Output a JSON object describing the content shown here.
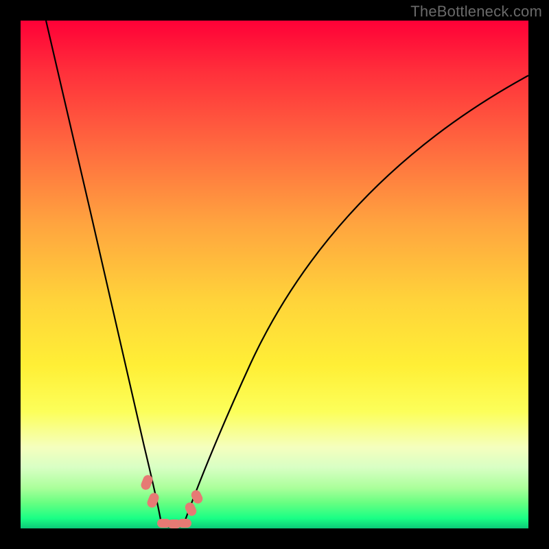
{
  "watermark": "TheBottleneck.com",
  "colors": {
    "frame_bg_top": "#ff0037",
    "frame_bg_bottom": "#0cc978",
    "curve_stroke": "#000000",
    "marker_fill": "#e67a74",
    "page_bg": "#000000",
    "watermark_text": "#6a6a6a"
  },
  "chart_data": {
    "type": "line",
    "title": "",
    "xlabel": "",
    "ylabel": "",
    "xlim": [
      0,
      100
    ],
    "ylim": [
      0,
      100
    ],
    "grid": false,
    "legend": false,
    "series": [
      {
        "name": "left-branch",
        "x": [
          5,
          8,
          11,
          14,
          17,
          20,
          22,
          24,
          25.5,
          26.5,
          27,
          27.5
        ],
        "y": [
          100,
          88,
          76,
          64,
          52,
          39,
          27,
          15,
          7,
          3,
          1.5,
          0
        ]
      },
      {
        "name": "valley-floor",
        "x": [
          27.5,
          29,
          30.5,
          32
        ],
        "y": [
          0,
          0,
          0,
          0
        ]
      },
      {
        "name": "right-branch",
        "x": [
          32,
          33.5,
          36,
          40,
          45,
          51,
          58,
          66,
          75,
          85,
          95,
          100
        ],
        "y": [
          0,
          3,
          10,
          22,
          35,
          47,
          58,
          67,
          75,
          82,
          87,
          89
        ]
      }
    ],
    "markers": [
      {
        "name": "left-pair-upper",
        "x": 25.5,
        "y": 7
      },
      {
        "name": "left-pair-lower",
        "x": 26.5,
        "y": 3
      },
      {
        "name": "floor-left",
        "x": 28.3,
        "y": 0
      },
      {
        "name": "floor-mid",
        "x": 30,
        "y": 0
      },
      {
        "name": "floor-right",
        "x": 31.7,
        "y": 0
      },
      {
        "name": "right-lower",
        "x": 33.5,
        "y": 3
      },
      {
        "name": "right-upper",
        "x": 34.5,
        "y": 5.5
      }
    ]
  }
}
